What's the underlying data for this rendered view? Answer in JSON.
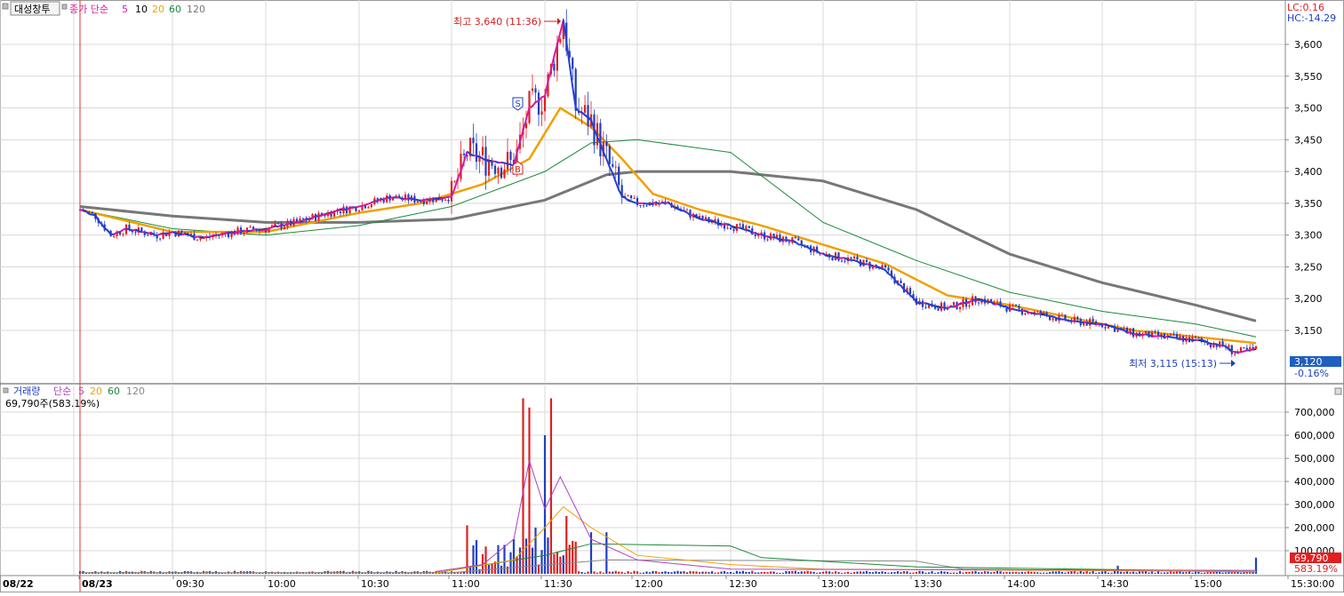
{
  "price_panel": {
    "stock_name": "대성창투",
    "ma_label": "종가 단순",
    "ma_periods": [
      {
        "label": "5",
        "color": "#d81b9e"
      },
      {
        "label": "10",
        "color": "#000000"
      },
      {
        "label": "20",
        "color": "#f0a000"
      },
      {
        "label": "60",
        "color": "#1a8a3a"
      },
      {
        "label": "120",
        "color": "#777777"
      }
    ],
    "lc_label": "LC:0.16",
    "hc_label": "HC:-14.29",
    "y_ticks": [
      "3,600",
      "3,550",
      "3,500",
      "3,450",
      "3,400",
      "3,350",
      "3,300",
      "3,250",
      "3,200",
      "3,150"
    ],
    "current_price": "3,120",
    "current_change": "-0.16%",
    "high_annotation": "최고 3,640 (11:36)",
    "low_annotation": "최저 3,115 (15:13)",
    "signal_sell": "S",
    "signal_buy": "B"
  },
  "volume_panel": {
    "title": "거래량",
    "ma_label": "단순",
    "ma_periods": [
      {
        "label": "5",
        "color": "#b040c0"
      },
      {
        "label": "20",
        "color": "#f0a000"
      },
      {
        "label": "60",
        "color": "#1a8a3a"
      },
      {
        "label": "120",
        "color": "#888888"
      }
    ],
    "summary": "69,790주(583.19%)",
    "y_ticks": [
      "700,000",
      "600,000",
      "500,000",
      "400,000",
      "300,000",
      "200,000",
      "100,000"
    ],
    "current_volume": "69,790",
    "current_ratio": "583.19%"
  },
  "x_axis": {
    "labels": [
      "08/22",
      "08/23",
      "09:30",
      "10:00",
      "10:30",
      "11:00",
      "11:30",
      "12:00",
      "12:30",
      "13:00",
      "13:30",
      "14:00",
      "14:30",
      "15:00",
      "15:30:00"
    ]
  },
  "colors": {
    "up": "#e02020",
    "down": "#1f3fc0",
    "grid": "#d8d8d8"
  },
  "chart_data": {
    "type": "line",
    "price_points": [
      [
        "09:00",
        3340
      ],
      [
        "09:05",
        3330
      ],
      [
        "09:10",
        3300
      ],
      [
        "09:15",
        3310
      ],
      [
        "09:20",
        3305
      ],
      [
        "09:25",
        3300
      ],
      [
        "09:30",
        3305
      ],
      [
        "09:40",
        3295
      ],
      [
        "09:50",
        3305
      ],
      [
        "10:00",
        3310
      ],
      [
        "10:10",
        3320
      ],
      [
        "10:20",
        3335
      ],
      [
        "10:30",
        3345
      ],
      [
        "10:40",
        3360
      ],
      [
        "10:50",
        3355
      ],
      [
        "11:00",
        3360
      ],
      [
        "11:05",
        3430
      ],
      [
        "11:10",
        3420
      ],
      [
        "11:20",
        3410
      ],
      [
        "11:25",
        3500
      ],
      [
        "11:30",
        3520
      ],
      [
        "11:36",
        3640
      ],
      [
        "11:40",
        3500
      ],
      [
        "11:45",
        3480
      ],
      [
        "11:50",
        3420
      ],
      [
        "11:55",
        3360
      ],
      [
        "12:00",
        3350
      ],
      [
        "12:10",
        3350
      ],
      [
        "12:20",
        3325
      ],
      [
        "12:30",
        3315
      ],
      [
        "12:40",
        3300
      ],
      [
        "12:50",
        3290
      ],
      [
        "13:00",
        3270
      ],
      [
        "13:10",
        3260
      ],
      [
        "13:20",
        3245
      ],
      [
        "13:30",
        3195
      ],
      [
        "13:40",
        3185
      ],
      [
        "13:50",
        3200
      ],
      [
        "14:00",
        3185
      ],
      [
        "14:10",
        3175
      ],
      [
        "14:20",
        3165
      ],
      [
        "14:30",
        3160
      ],
      [
        "14:40",
        3145
      ],
      [
        "14:50",
        3140
      ],
      [
        "15:00",
        3135
      ],
      [
        "15:10",
        3125
      ],
      [
        "15:13",
        3115
      ],
      [
        "15:20",
        3120
      ]
    ],
    "ma20": [
      [
        "09:00",
        3340
      ],
      [
        "09:30",
        3305
      ],
      [
        "10:00",
        3305
      ],
      [
        "10:30",
        3335
      ],
      [
        "10:50",
        3350
      ],
      [
        "11:10",
        3380
      ],
      [
        "11:25",
        3420
      ],
      [
        "11:35",
        3500
      ],
      [
        "11:45",
        3470
      ],
      [
        "11:55",
        3420
      ],
      [
        "12:05",
        3365
      ],
      [
        "12:20",
        3340
      ],
      [
        "12:40",
        3315
      ],
      [
        "13:00",
        3285
      ],
      [
        "13:20",
        3255
      ],
      [
        "13:40",
        3205
      ],
      [
        "14:00",
        3190
      ],
      [
        "14:20",
        3170
      ],
      [
        "14:40",
        3150
      ],
      [
        "15:00",
        3140
      ],
      [
        "15:20",
        3130
      ]
    ],
    "ma60": [
      [
        "09:00",
        3340
      ],
      [
        "09:30",
        3310
      ],
      [
        "10:00",
        3300
      ],
      [
        "10:30",
        3315
      ],
      [
        "11:00",
        3345
      ],
      [
        "11:30",
        3400
      ],
      [
        "11:45",
        3445
      ],
      [
        "12:00",
        3450
      ],
      [
        "12:30",
        3430
      ],
      [
        "13:00",
        3320
      ],
      [
        "13:30",
        3260
      ],
      [
        "14:00",
        3210
      ],
      [
        "14:30",
        3180
      ],
      [
        "15:00",
        3160
      ],
      [
        "15:20",
        3140
      ]
    ],
    "ma120": [
      [
        "09:00",
        3345
      ],
      [
        "09:30",
        3330
      ],
      [
        "10:00",
        3320
      ],
      [
        "10:30",
        3320
      ],
      [
        "11:00",
        3325
      ],
      [
        "11:30",
        3355
      ],
      [
        "11:50",
        3395
      ],
      [
        "12:00",
        3400
      ],
      [
        "12:30",
        3400
      ],
      [
        "13:00",
        3385
      ],
      [
        "13:30",
        3340
      ],
      [
        "14:00",
        3270
      ],
      [
        "14:30",
        3225
      ],
      [
        "15:00",
        3190
      ],
      [
        "15:20",
        3165
      ]
    ],
    "volume_spikes": [
      [
        "11:05",
        210000
      ],
      [
        "11:20",
        150000
      ],
      [
        "11:23",
        760000
      ],
      [
        "11:25",
        720000
      ],
      [
        "11:27",
        200000
      ],
      [
        "11:30",
        600000
      ],
      [
        "11:32",
        760000
      ],
      [
        "11:37",
        250000
      ],
      [
        "11:45",
        180000
      ],
      [
        "11:50",
        180000
      ],
      [
        "14:35",
        35000
      ],
      [
        "15:20",
        69790
      ]
    ],
    "volume_ma5": [
      [
        "10:55",
        10000
      ],
      [
        "11:10",
        40000
      ],
      [
        "11:20",
        150000
      ],
      [
        "11:25",
        490000
      ],
      [
        "11:30",
        280000
      ],
      [
        "11:35",
        420000
      ],
      [
        "11:45",
        150000
      ],
      [
        "12:00",
        60000
      ],
      [
        "12:30",
        20000
      ],
      [
        "15:20",
        15000
      ]
    ],
    "volume_ma20": [
      [
        "10:55",
        5000
      ],
      [
        "11:20",
        60000
      ],
      [
        "11:30",
        200000
      ],
      [
        "11:36",
        290000
      ],
      [
        "11:45",
        200000
      ],
      [
        "12:00",
        80000
      ],
      [
        "12:30",
        40000
      ],
      [
        "13:00",
        20000
      ],
      [
        "15:20",
        10000
      ]
    ],
    "volume_ma60": [
      [
        "10:55",
        5000
      ],
      [
        "11:30",
        80000
      ],
      [
        "11:45",
        130000
      ],
      [
        "12:30",
        120000
      ],
      [
        "12:40",
        70000
      ],
      [
        "13:30",
        30000
      ],
      [
        "15:20",
        10000
      ]
    ],
    "volume_ma120": [
      [
        "09:00",
        5000
      ],
      [
        "11:00",
        5000
      ],
      [
        "11:50",
        60000
      ],
      [
        "13:30",
        55000
      ],
      [
        "13:45",
        20000
      ],
      [
        "15:20",
        8000
      ]
    ]
  }
}
